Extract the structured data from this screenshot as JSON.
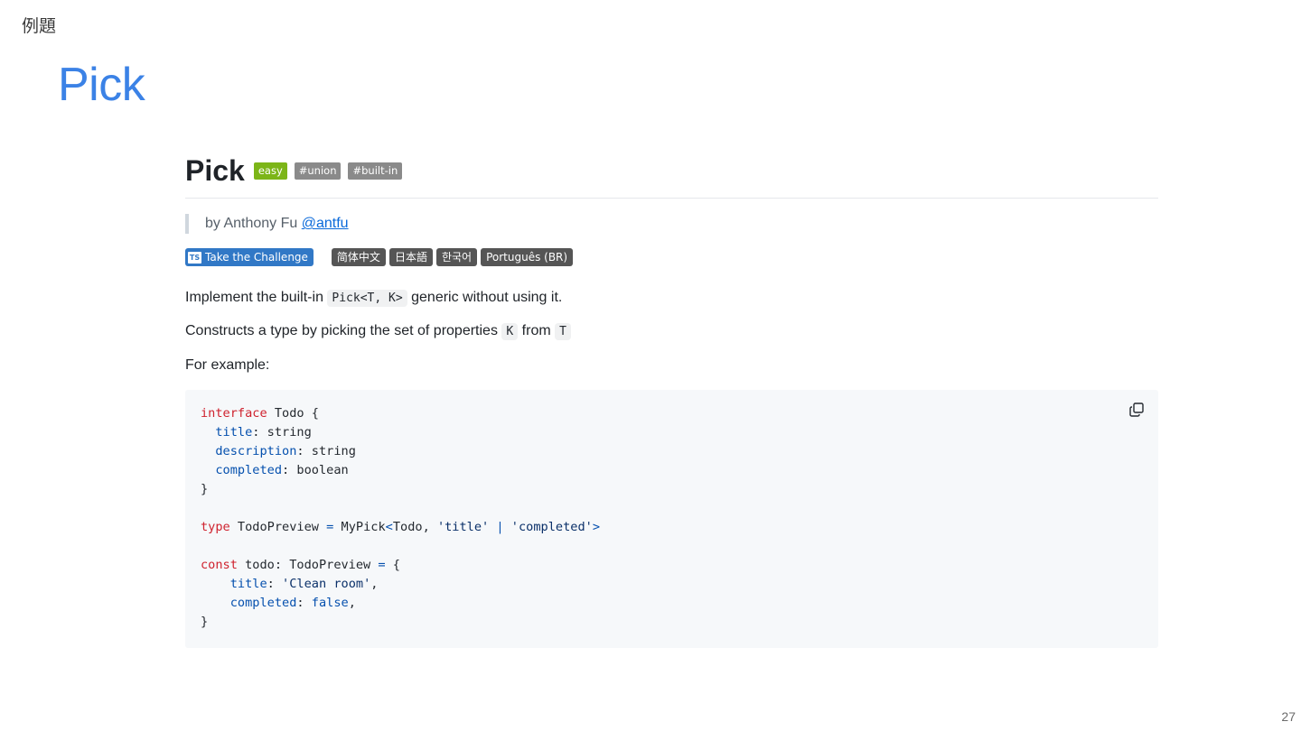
{
  "slide": {
    "section_label": "例題",
    "title": "Pick",
    "page_number": "27"
  },
  "challenge": {
    "heading": "Pick",
    "tags": [
      "easy",
      "#union",
      "#built-in"
    ],
    "byline_prefix": "by Anthony Fu",
    "author_handle": "@antfu",
    "take_challenge_label": "Take the Challenge",
    "ts_badge_icon": "TS",
    "languages": [
      "简体中文",
      "日本語",
      "한국어",
      "Português (BR)"
    ],
    "paragraph1": {
      "before": "Implement the built-in ",
      "code": "Pick<T, K>",
      "after": " generic without using it."
    },
    "paragraph2": {
      "before": "Constructs a type by picking the set of properties ",
      "code1": "K",
      "middle": " from ",
      "code2": "T"
    },
    "paragraph3": "For example:",
    "copy_icon": "copy-icon"
  },
  "code": [
    [
      [
        "kw",
        "interface"
      ],
      [
        "plain",
        " Todo {"
      ]
    ],
    [
      [
        "plain",
        "  "
      ],
      [
        "prop",
        "title"
      ],
      [
        "plain",
        ": string"
      ]
    ],
    [
      [
        "plain",
        "  "
      ],
      [
        "prop",
        "description"
      ],
      [
        "plain",
        ": string"
      ]
    ],
    [
      [
        "plain",
        "  "
      ],
      [
        "prop",
        "completed"
      ],
      [
        "plain",
        ": boolean"
      ]
    ],
    [
      [
        "plain",
        "}"
      ]
    ],
    [],
    [
      [
        "kw",
        "type"
      ],
      [
        "plain",
        " TodoPreview "
      ],
      [
        "op",
        "="
      ],
      [
        "plain",
        " MyPick"
      ],
      [
        "op",
        "<"
      ],
      [
        "plain",
        "Todo, "
      ],
      [
        "str",
        "'title'"
      ],
      [
        "plain",
        " "
      ],
      [
        "op",
        "|"
      ],
      [
        "plain",
        " "
      ],
      [
        "str",
        "'completed'"
      ],
      [
        "op",
        ">"
      ]
    ],
    [],
    [
      [
        "kw",
        "const"
      ],
      [
        "plain",
        " todo: TodoPreview "
      ],
      [
        "op",
        "="
      ],
      [
        "plain",
        " {"
      ]
    ],
    [
      [
        "plain",
        "    "
      ],
      [
        "prop",
        "title"
      ],
      [
        "plain",
        ": "
      ],
      [
        "str",
        "'Clean room'"
      ],
      [
        "plain",
        ","
      ]
    ],
    [
      [
        "plain",
        "    "
      ],
      [
        "prop",
        "completed"
      ],
      [
        "plain",
        ": "
      ],
      [
        "lit",
        "false"
      ],
      [
        "plain",
        ","
      ]
    ],
    [
      [
        "plain",
        "}"
      ]
    ]
  ],
  "colors": {
    "kw": "#cf222e",
    "prop": "#0550ae",
    "str": "#0a3069",
    "op": "#0550ae",
    "lit": "#0550ae",
    "plain": "#24292f"
  }
}
